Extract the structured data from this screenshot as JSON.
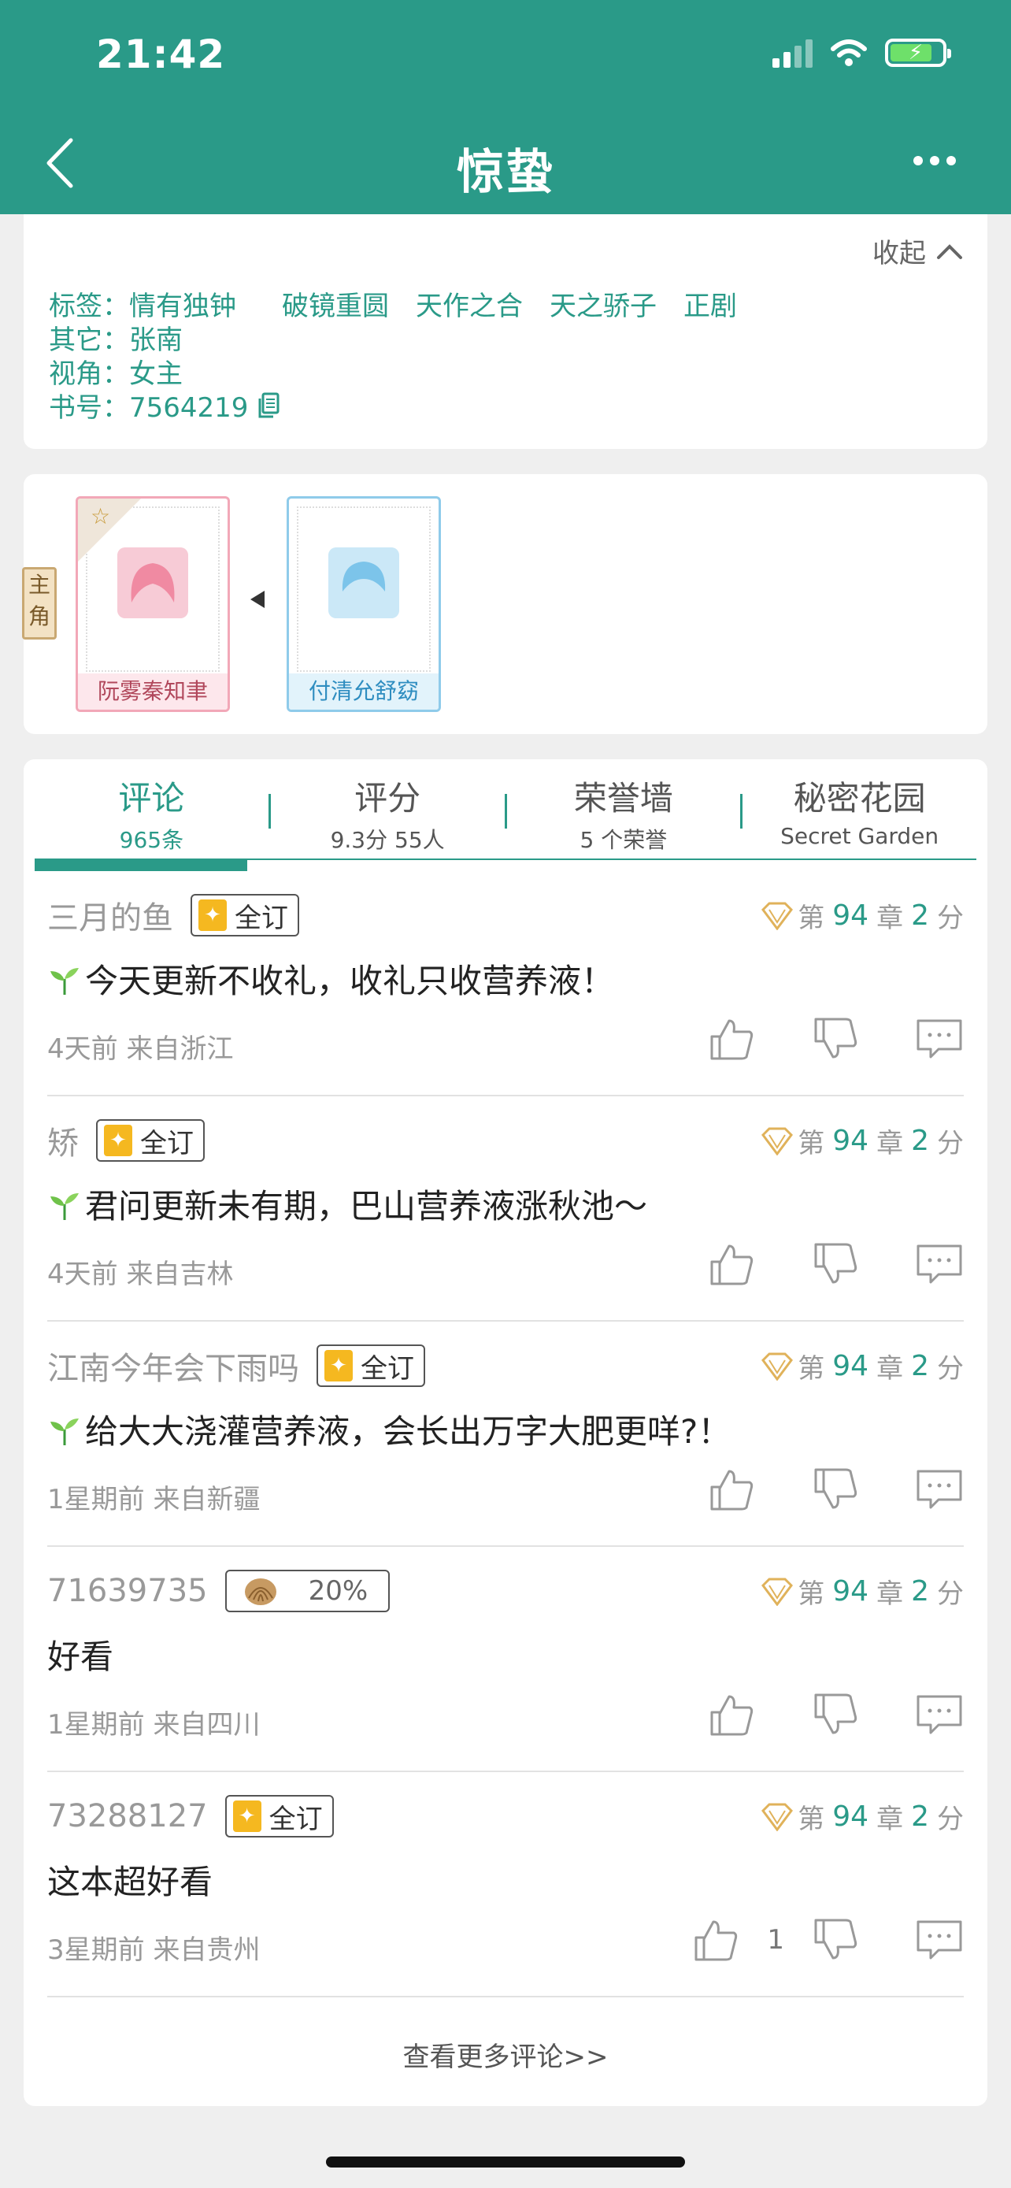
{
  "status": {
    "time": "21:42"
  },
  "header": {
    "title": "惊蛰"
  },
  "info": {
    "collapse_label": "收起",
    "tags_label": "标签：",
    "tags": [
      "情有独钟",
      "破镜重圆",
      "天作之合",
      "天之骄子",
      "正剧"
    ],
    "other_label": "其它：",
    "other_value": "张南",
    "view_label": "视角：",
    "view_value": "女主",
    "book_no_label": "书号：",
    "book_no_value": "7564219"
  },
  "roles": {
    "side_label_1": "主",
    "side_label_2": "角",
    "items": [
      {
        "name": "阮雾秦知聿"
      },
      {
        "name": "付清允舒窈"
      }
    ]
  },
  "tabs": [
    {
      "label": "评论",
      "sub": "965条"
    },
    {
      "label": "评分",
      "sub": "9.3分 55人"
    },
    {
      "label": "荣誉墙",
      "sub": "5 个荣誉"
    },
    {
      "label": "秘密花园",
      "sub": "Secret Garden"
    }
  ],
  "comments": [
    {
      "user": "三月的鱼",
      "badge": "全订",
      "chapter_prefix": "第",
      "chapter": "94",
      "chapter_suffix": "章",
      "score": "2",
      "score_suffix": "分",
      "text": "今天更新不收礼，收礼只收营养液！",
      "meta": "4天前  来自浙江"
    },
    {
      "user": "矫",
      "badge": "全订",
      "chapter_prefix": "第",
      "chapter": "94",
      "chapter_suffix": "章",
      "score": "2",
      "score_suffix": "分",
      "text": "君问更新未有期，巴山营养液涨秋池～",
      "meta": "4天前  来自吉林"
    },
    {
      "user": "江南今年会下雨吗",
      "badge": "全订",
      "chapter_prefix": "第",
      "chapter": "94",
      "chapter_suffix": "章",
      "score": "2",
      "score_suffix": "分",
      "text": "给大大浇灌营养液，会长出万字大肥更咩?！",
      "meta": "1星期前  来自新疆"
    },
    {
      "user": "71639735",
      "badge": "20%",
      "chapter_prefix": "第",
      "chapter": "94",
      "chapter_suffix": "章",
      "score": "2",
      "score_suffix": "分",
      "text": "好看",
      "meta": "1星期前  来自四川"
    },
    {
      "user": "73288127",
      "badge": "全订",
      "chapter_prefix": "第",
      "chapter": "94",
      "chapter_suffix": "章",
      "score": "2",
      "score_suffix": "分",
      "text": "这本超好看",
      "meta": "3星期前  来自贵州",
      "likes": "1"
    }
  ],
  "more_comments": "查看更多评论>>",
  "colors": {
    "brand": "#2a9a88",
    "badge": "#f5b820"
  }
}
